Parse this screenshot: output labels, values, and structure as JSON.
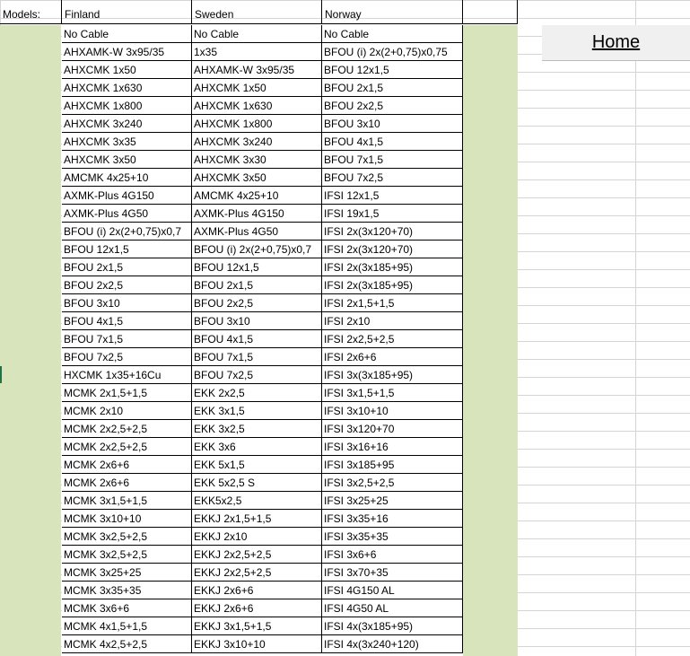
{
  "sheet": {
    "models_label": "Models:",
    "columns": [
      "Finland",
      "Sweden",
      "Norway"
    ],
    "home_button": "Home",
    "rows": [
      [
        "No Cable",
        "No Cable",
        "No Cable"
      ],
      [
        "AHXAMK-W 3x95/35",
        "1x35",
        "BFOU (i) 2x(2+0,75)x0,75"
      ],
      [
        "AHXCMK 1x50",
        "AHXAMK-W 3x95/35",
        "BFOU 12x1,5"
      ],
      [
        "AHXCMK 1x630",
        "AHXCMK 1x50",
        "BFOU 2x1,5"
      ],
      [
        "AHXCMK 1x800",
        "AHXCMK 1x630",
        "BFOU 2x2,5"
      ],
      [
        "AHXCMK 3x240",
        "AHXCMK 1x800",
        "BFOU 3x10"
      ],
      [
        "AHXCMK 3x35",
        "AHXCMK 3x240",
        "BFOU 4x1,5"
      ],
      [
        "AHXCMK 3x50",
        "AHXCMK 3x30",
        "BFOU 7x1,5"
      ],
      [
        "AMCMK 4x25+10",
        "AHXCMK 3x50",
        "BFOU 7x2,5"
      ],
      [
        "AXMK-Plus 4G150",
        "AMCMK 4x25+10",
        "IFSI 12x1,5"
      ],
      [
        "AXMK-Plus 4G50",
        "AXMK-Plus 4G150",
        "IFSI 19x1,5"
      ],
      [
        "BFOU (i) 2x(2+0,75)x0,7",
        "AXMK-Plus 4G50",
        "IFSI 2x(3x120+70)"
      ],
      [
        "BFOU 12x1,5",
        "BFOU (i) 2x(2+0,75)x0,7",
        "IFSI 2x(3x120+70)"
      ],
      [
        "BFOU 2x1,5",
        "BFOU 12x1,5",
        "IFSI 2x(3x185+95)"
      ],
      [
        "BFOU 2x2,5",
        "BFOU 2x1,5",
        "IFSI 2x(3x185+95)"
      ],
      [
        "BFOU 3x10",
        "BFOU 2x2,5",
        "IFSI 2x1,5+1,5"
      ],
      [
        "BFOU 4x1,5",
        "BFOU 3x10",
        "IFSI 2x10"
      ],
      [
        "BFOU 7x1,5",
        "BFOU 4x1,5",
        "IFSI 2x2,5+2,5"
      ],
      [
        "BFOU 7x2,5",
        "BFOU 7x1,5",
        "IFSI 2x6+6"
      ],
      [
        "HXCMK 1x35+16Cu",
        "BFOU 7x2,5",
        "IFSI 3x(3x185+95)"
      ],
      [
        "MCMK 2x1,5+1,5",
        "EKK 2x2,5",
        "IFSI 3x1,5+1,5"
      ],
      [
        "MCMK 2x10",
        "EKK 3x1,5",
        "IFSI 3x10+10"
      ],
      [
        "MCMK 2x2,5+2,5",
        "EKK 3x2,5",
        "IFSI 3x120+70"
      ],
      [
        "MCMK 2x2,5+2,5",
        "EKK 3x6",
        "IFSI 3x16+16"
      ],
      [
        "MCMK 2x6+6",
        "EKK 5x1,5",
        "IFSI 3x185+95"
      ],
      [
        "MCMK 2x6+6",
        "EKK 5x2,5 S",
        "IFSI 3x2,5+2,5"
      ],
      [
        "MCMK 3x1,5+1,5",
        "EKK5x2,5",
        "IFSI 3x25+25"
      ],
      [
        "MCMK 3x10+10",
        "EKKJ 2x1,5+1,5",
        "IFSI 3x35+16"
      ],
      [
        "MCMK 3x2,5+2,5",
        "EKKJ 2x10",
        "IFSI 3x35+35"
      ],
      [
        "MCMK 3x2,5+2,5",
        "EKKJ 2x2,5+2,5",
        "IFSI 3x6+6"
      ],
      [
        "MCMK 3x25+25",
        "EKKJ 2x2,5+2,5",
        "IFSI 3x70+35"
      ],
      [
        "MCMK 3x35+35",
        "EKKJ 2x6+6",
        "IFSI 4G150 AL"
      ],
      [
        "MCMK 3x6+6",
        "EKKJ 2x6+6",
        "IFSI 4G50 AL"
      ],
      [
        "MCMK 4x1,5+1,5",
        "EKKJ 3x1,5+1,5",
        "IFSI 4x(3x185+95)"
      ],
      [
        "MCMK 4x2,5+2,5",
        "EKKJ 3x10+10",
        "IFSI 4x(3x240+120)"
      ]
    ]
  }
}
